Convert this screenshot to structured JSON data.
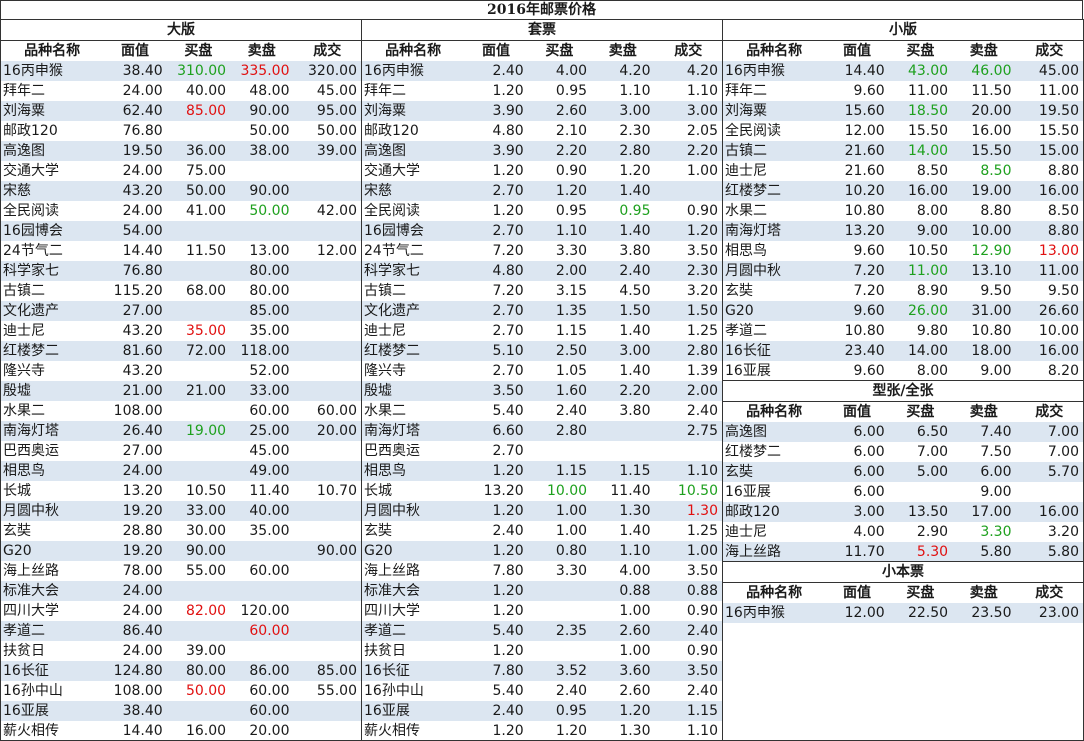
{
  "title": "2016年邮票价格",
  "colors": {
    "shade": "#dce6f1",
    "green": "#1ea01e",
    "red": "#e01010"
  },
  "headers": [
    "品种名称",
    "面值",
    "买盘",
    "卖盘",
    "成交"
  ],
  "panels": {
    "daban": {
      "title": "大版",
      "rows": [
        [
          "16丙申猴",
          "38.40",
          "310.00",
          "335.00",
          "320.00"
        ],
        [
          "拜年二",
          "24.00",
          "40.00",
          "48.00",
          "45.00"
        ],
        [
          "刘海粟",
          "62.40",
          "85.00",
          "90.00",
          "95.00"
        ],
        [
          "邮政120",
          "76.80",
          "",
          "50.00",
          "50.00"
        ],
        [
          "高逸图",
          "19.50",
          "36.00",
          "38.00",
          "39.00"
        ],
        [
          "交通大学",
          "24.00",
          "75.00",
          "",
          ""
        ],
        [
          "宋慈",
          "43.20",
          "50.00",
          "90.00",
          ""
        ],
        [
          "全民阅读",
          "24.00",
          "41.00",
          "50.00",
          "42.00"
        ],
        [
          "16园博会",
          "54.00",
          "",
          "",
          ""
        ],
        [
          "24节气二",
          "14.40",
          "11.50",
          "13.00",
          "12.00"
        ],
        [
          "科学家七",
          "76.80",
          "",
          "80.00",
          ""
        ],
        [
          "古镇二",
          "115.20",
          "68.00",
          "80.00",
          ""
        ],
        [
          "文化遗产",
          "27.00",
          "",
          "85.00",
          ""
        ],
        [
          "迪士尼",
          "43.20",
          "35.00",
          "35.00",
          ""
        ],
        [
          "红楼梦二",
          "81.60",
          "72.00",
          "118.00",
          ""
        ],
        [
          "隆兴寺",
          "43.20",
          "",
          "52.00",
          ""
        ],
        [
          "殷墟",
          "21.00",
          "21.00",
          "33.00",
          ""
        ],
        [
          "水果二",
          "108.00",
          "",
          "60.00",
          "60.00"
        ],
        [
          "南海灯塔",
          "26.40",
          "19.00",
          "25.00",
          "20.00"
        ],
        [
          "巴西奥运",
          "27.00",
          "",
          "45.00",
          ""
        ],
        [
          "相思鸟",
          "24.00",
          "",
          "49.00",
          ""
        ],
        [
          "长城",
          "13.20",
          "10.50",
          "11.40",
          "10.70"
        ],
        [
          "月圆中秋",
          "19.20",
          "33.00",
          "40.00",
          ""
        ],
        [
          "玄奘",
          "28.80",
          "30.00",
          "35.00",
          ""
        ],
        [
          "G20",
          "19.20",
          "90.00",
          "",
          "90.00"
        ],
        [
          "海上丝路",
          "78.00",
          "55.00",
          "60.00",
          ""
        ],
        [
          "标准大会",
          "24.00",
          "",
          "",
          ""
        ],
        [
          "四川大学",
          "24.00",
          "82.00",
          "120.00",
          ""
        ],
        [
          "孝道二",
          "86.40",
          "",
          "60.00",
          ""
        ],
        [
          "扶贫日",
          "24.00",
          "39.00",
          "",
          ""
        ],
        [
          "16长征",
          "124.80",
          "80.00",
          "86.00",
          "85.00"
        ],
        [
          "16孙中山",
          "108.00",
          "50.00",
          "60.00",
          "55.00"
        ],
        [
          "16亚展",
          "38.40",
          "",
          "60.00",
          ""
        ],
        [
          "薪火相传",
          "14.40",
          "16.00",
          "20.00",
          ""
        ]
      ]
    },
    "taopiao": {
      "title": "套票",
      "rows": [
        [
          "16丙申猴",
          "2.40",
          "4.00",
          "4.20",
          "4.20"
        ],
        [
          "拜年二",
          "1.20",
          "0.95",
          "1.10",
          "1.10"
        ],
        [
          "刘海粟",
          "3.90",
          "2.60",
          "3.00",
          "3.00"
        ],
        [
          "邮政120",
          "4.80",
          "2.10",
          "2.30",
          "2.05"
        ],
        [
          "高逸图",
          "3.90",
          "2.20",
          "2.80",
          "2.20"
        ],
        [
          "交通大学",
          "1.20",
          "0.90",
          "1.20",
          "1.00"
        ],
        [
          "宋慈",
          "2.70",
          "1.20",
          "1.40",
          ""
        ],
        [
          "全民阅读",
          "1.20",
          "0.95",
          "0.95",
          "0.90"
        ],
        [
          "16园博会",
          "2.70",
          "1.10",
          "1.40",
          "1.20"
        ],
        [
          "24节气二",
          "7.20",
          "3.30",
          "3.80",
          "3.50"
        ],
        [
          "科学家七",
          "4.80",
          "2.00",
          "2.40",
          "2.30"
        ],
        [
          "古镇二",
          "7.20",
          "3.15",
          "4.50",
          "3.20"
        ],
        [
          "文化遗产",
          "2.70",
          "1.35",
          "1.50",
          "1.50"
        ],
        [
          "迪士尼",
          "2.70",
          "1.15",
          "1.40",
          "1.25"
        ],
        [
          "红楼梦二",
          "5.10",
          "2.50",
          "3.00",
          "2.80"
        ],
        [
          "隆兴寺",
          "2.70",
          "1.05",
          "1.40",
          "1.39"
        ],
        [
          "殷墟",
          "3.50",
          "1.60",
          "2.20",
          "2.00"
        ],
        [
          "水果二",
          "5.40",
          "2.40",
          "3.80",
          "2.40"
        ],
        [
          "南海灯塔",
          "6.60",
          "2.80",
          "",
          "2.75"
        ],
        [
          "巴西奥运",
          "2.70",
          "",
          "",
          ""
        ],
        [
          "相思鸟",
          "1.20",
          "1.15",
          "1.15",
          "1.10"
        ],
        [
          "长城",
          "13.20",
          "10.00",
          "11.40",
          "10.50"
        ],
        [
          "月圆中秋",
          "1.20",
          "1.00",
          "1.30",
          "1.30"
        ],
        [
          "玄奘",
          "2.40",
          "1.00",
          "1.40",
          "1.25"
        ],
        [
          "G20",
          "1.20",
          "0.80",
          "1.10",
          "1.00"
        ],
        [
          "海上丝路",
          "7.80",
          "3.30",
          "4.00",
          "3.50"
        ],
        [
          "标准大会",
          "1.20",
          "",
          "0.88",
          "0.88"
        ],
        [
          "四川大学",
          "1.20",
          "",
          "1.00",
          "0.90"
        ],
        [
          "孝道二",
          "5.40",
          "2.35",
          "2.60",
          "2.40"
        ],
        [
          "扶贫日",
          "1.20",
          "",
          "1.00",
          "0.90"
        ],
        [
          "16长征",
          "7.80",
          "3.52",
          "3.60",
          "3.50"
        ],
        [
          "16孙中山",
          "5.40",
          "2.40",
          "2.60",
          "2.40"
        ],
        [
          "16亚展",
          "2.40",
          "0.95",
          "1.20",
          "1.15"
        ],
        [
          "薪火相传",
          "1.20",
          "1.20",
          "1.30",
          "1.10"
        ]
      ]
    },
    "xiaoban": {
      "title": "小版",
      "rows": [
        [
          "16丙申猴",
          "14.40",
          "43.00",
          "46.00",
          "45.00"
        ],
        [
          "拜年二",
          "9.60",
          "11.00",
          "11.50",
          "11.00"
        ],
        [
          "刘海粟",
          "15.60",
          "18.50",
          "20.00",
          "19.50"
        ],
        [
          "全民阅读",
          "12.00",
          "15.50",
          "16.00",
          "15.50"
        ],
        [
          "古镇二",
          "21.60",
          "14.00",
          "15.50",
          "15.00"
        ],
        [
          "迪士尼",
          "21.60",
          "8.50",
          "8.50",
          "8.80"
        ],
        [
          "红楼梦二",
          "10.20",
          "16.00",
          "19.00",
          "16.00"
        ],
        [
          "水果二",
          "10.80",
          "8.00",
          "8.80",
          "8.50"
        ],
        [
          "南海灯塔",
          "13.20",
          "9.00",
          "10.00",
          "8.80"
        ],
        [
          "相思鸟",
          "9.60",
          "10.50",
          "12.90",
          "13.00"
        ],
        [
          "月圆中秋",
          "7.20",
          "11.00",
          "13.10",
          "11.00"
        ],
        [
          "玄奘",
          "7.20",
          "8.90",
          "9.50",
          "9.50"
        ],
        [
          "G20",
          "9.60",
          "26.00",
          "31.00",
          "26.60"
        ],
        [
          "孝道二",
          "10.80",
          "9.80",
          "10.80",
          "10.00"
        ],
        [
          "16长征",
          "23.40",
          "14.00",
          "18.00",
          "16.00"
        ],
        [
          "16亚展",
          "9.60",
          "8.00",
          "9.00",
          "8.20"
        ]
      ]
    },
    "xingzhang": {
      "title": "型张/全张",
      "rows": [
        [
          "高逸图",
          "6.00",
          "6.50",
          "7.40",
          "7.00"
        ],
        [
          "红楼梦二",
          "6.00",
          "7.00",
          "7.50",
          "7.00"
        ],
        [
          "玄奘",
          "6.00",
          "5.00",
          "6.00",
          "5.70"
        ],
        [
          "16亚展",
          "6.00",
          "",
          "9.00",
          ""
        ],
        [
          "邮政120",
          "3.00",
          "13.50",
          "17.00",
          "16.00"
        ],
        [
          "迪士尼",
          "4.00",
          "2.90",
          "3.30",
          "3.20"
        ],
        [
          "海上丝路",
          "11.70",
          "5.30",
          "5.80",
          "5.80"
        ]
      ]
    },
    "xiaobenpiao": {
      "title": "小本票",
      "rows": [
        [
          "16丙申猴",
          "12.00",
          "22.50",
          "23.50",
          "23.00"
        ]
      ]
    }
  },
  "highlights": {
    "daban": [
      [
        0,
        2,
        "green"
      ],
      [
        0,
        3,
        "red"
      ],
      [
        2,
        2,
        "red"
      ],
      [
        7,
        3,
        "green"
      ],
      [
        13,
        2,
        "red"
      ],
      [
        18,
        2,
        "green"
      ],
      [
        27,
        2,
        "red"
      ],
      [
        28,
        3,
        "red"
      ],
      [
        31,
        2,
        "red"
      ]
    ],
    "taopiao": [
      [
        7,
        3,
        "green"
      ],
      [
        21,
        2,
        "green"
      ],
      [
        21,
        4,
        "green"
      ],
      [
        22,
        4,
        "red"
      ]
    ],
    "xiaoban": [
      [
        0,
        2,
        "green"
      ],
      [
        0,
        3,
        "green"
      ],
      [
        2,
        2,
        "green"
      ],
      [
        4,
        2,
        "green"
      ],
      [
        5,
        3,
        "green"
      ],
      [
        9,
        3,
        "green"
      ],
      [
        9,
        4,
        "red"
      ],
      [
        10,
        2,
        "green"
      ],
      [
        12,
        2,
        "green"
      ]
    ],
    "xingzhang": [
      [
        5,
        3,
        "green"
      ],
      [
        6,
        2,
        "red"
      ]
    ],
    "xiaobenpiao": []
  }
}
